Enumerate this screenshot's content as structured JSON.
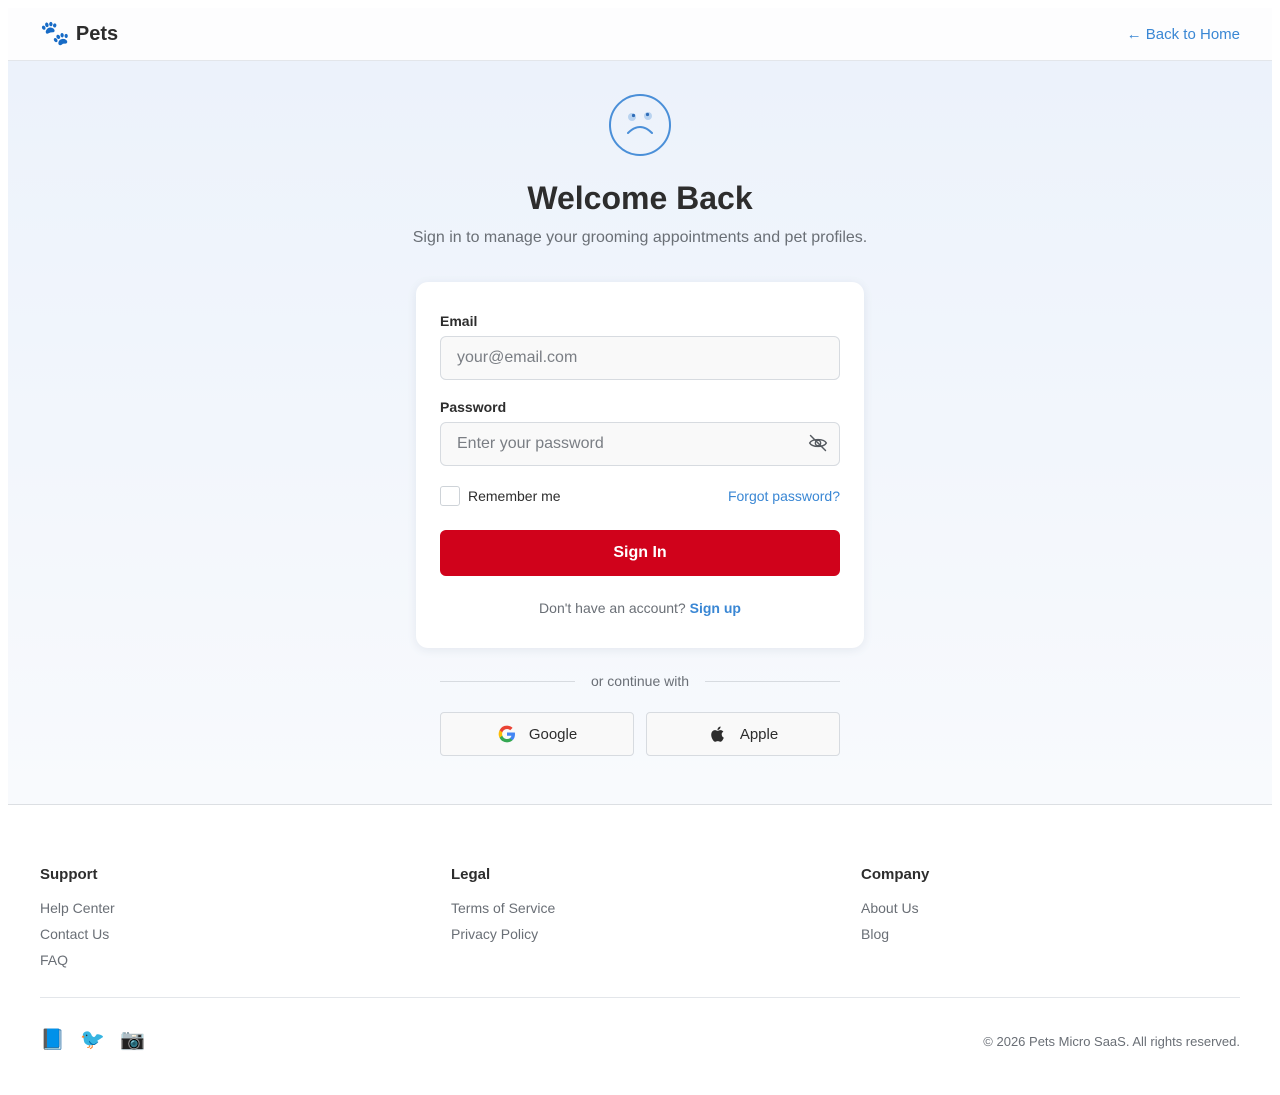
{
  "header": {
    "brand_icon": "paw-icon",
    "brand_name": "Pets",
    "back_link": "← Back to Home"
  },
  "hero": {
    "icon": "sad-face-icon",
    "title": "Welcome Back",
    "subtitle": "Sign in to manage your grooming appointments and pet profiles."
  },
  "form": {
    "email_label": "Email",
    "email_placeholder": "your@email.com",
    "email_value": "",
    "password_label": "Password",
    "password_placeholder": "Enter your password",
    "password_value": "",
    "remember_label": "Remember me",
    "remember_checked": false,
    "forgot_link": "Forgot password?",
    "submit_label": "Sign In",
    "signup_prompt": "Don't have an account?",
    "signup_link": "Sign up"
  },
  "social": {
    "divider_text": "or continue with",
    "google_label": "Google",
    "apple_label": "Apple"
  },
  "footer": {
    "columns": [
      {
        "heading": "Support",
        "links": [
          "Help Center",
          "Contact Us",
          "FAQ"
        ]
      },
      {
        "heading": "Legal",
        "links": [
          "Terms of Service",
          "Privacy Policy"
        ]
      },
      {
        "heading": "Company",
        "links": [
          "About Us",
          "Blog"
        ]
      }
    ],
    "social_icons": [
      "facebook-icon",
      "twitter-icon",
      "instagram-icon"
    ],
    "copyright": "© 2026 Pets Micro SaaS. All rights reserved."
  },
  "colors": {
    "accent": "#3a87d4",
    "primary_button": "#d0021b",
    "text": "#2d2d2d",
    "muted": "#6a6f76"
  }
}
